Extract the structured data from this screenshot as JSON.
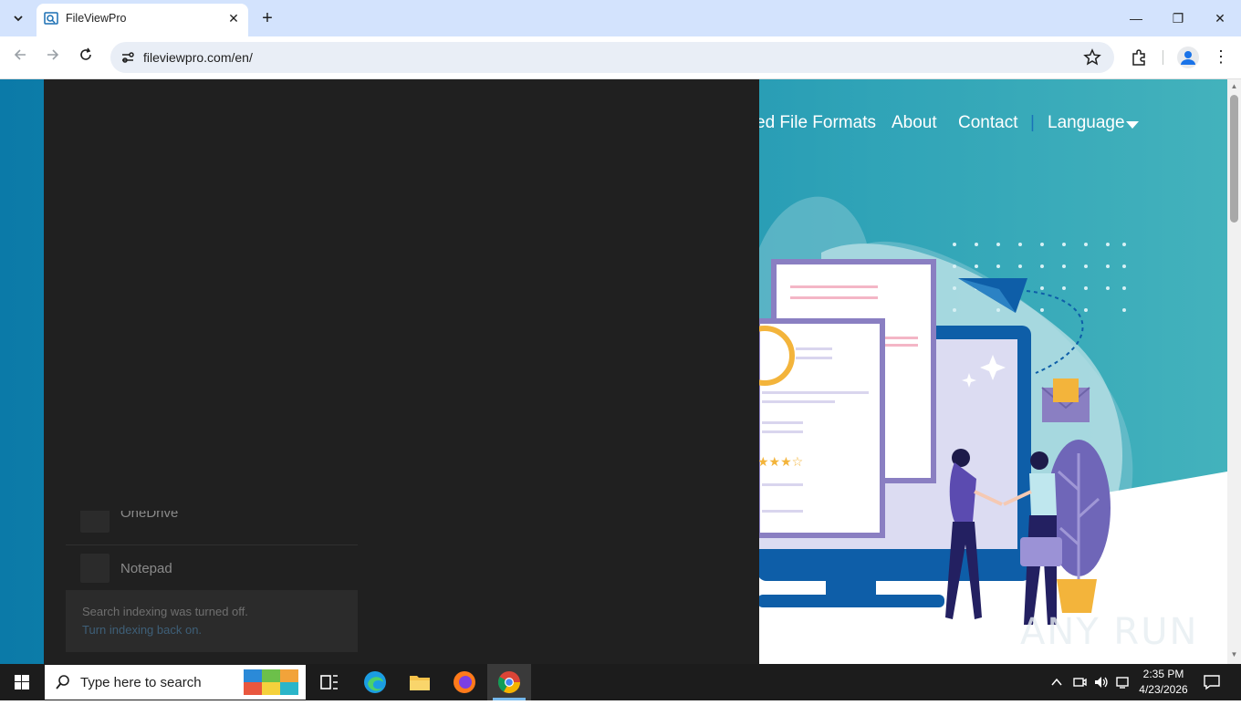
{
  "browser": {
    "tab_title": "FileViewPro",
    "tab_close": "✕",
    "new_tab": "+",
    "url": "fileviewpro.com/en/",
    "window_controls": {
      "minimize": "—",
      "restore": "❐",
      "close": "✕"
    }
  },
  "site": {
    "nav": [
      {
        "label": "ed File Formats"
      },
      {
        "label": "About"
      },
      {
        "label": "Contact"
      },
      {
        "label": "|"
      },
      {
        "label": "Language"
      }
    ],
    "hero_rating_stars": 3.5,
    "watermark": "ANY RUN"
  },
  "start_menu": {
    "apps": [
      {
        "label": "OneDrive"
      },
      {
        "label": "Notepad"
      }
    ],
    "indexing_message": "Search indexing was turned off.",
    "indexing_link": "Turn indexing back on."
  },
  "taskbar": {
    "search_placeholder": "Type here to search",
    "time": "2:35 PM",
    "date": "4/23/2026"
  },
  "colors": {
    "tab_strip": "#d3e3fd",
    "start_menu_bg": "#202020",
    "page_accent": "#1a8fb0",
    "taskbar": "#1c1c1c"
  }
}
